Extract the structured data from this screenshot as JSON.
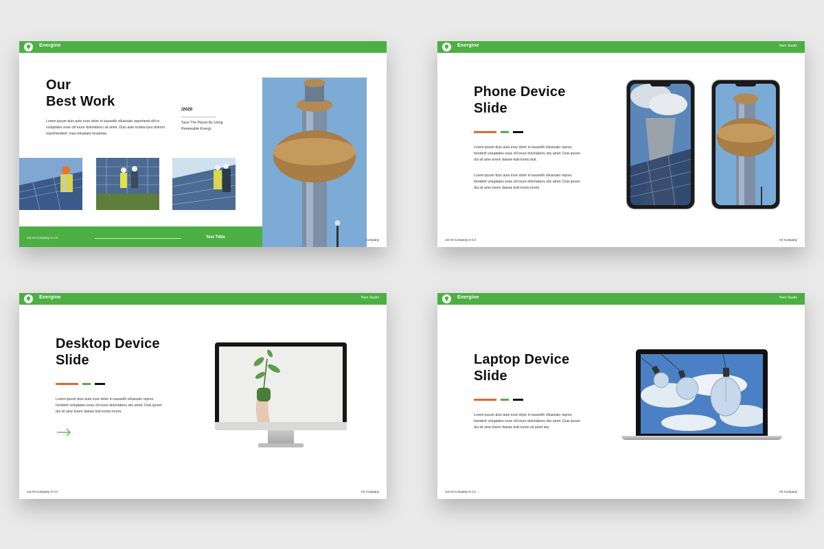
{
  "brand": "Energine",
  "studio": "Yeen Studio",
  "footer_left": "1st Art Company in CA",
  "footer_right": "Art Company",
  "slide1": {
    "title": "Our\nBest Work",
    "body": "Lorem ipsum duis aute irure dolor in kauselih ollusioalo reprehenit cilli in voluptates esse cill inure dolorlaboru sit amet. Duis aute irulsita ipsu dolorin reprehenderit. insa voluptate lorasinae.",
    "year": "/2020",
    "tagline": "Save The Planet By Using\nRenewable Energy",
    "green_label": "Test Tittle",
    "footer_right_partial": "Company"
  },
  "slide2": {
    "title": "Phone Device\nSlide",
    "body1": "Lorem ipsum duis aute irure dolor in kauselih ollusioalo repres henderit voluptates esse cill inure dolorlaboru sits amet. Duis ipsum dui sit ame lorem daiose kuili konto duit.",
    "body2": "Lorem ipsum duis aute irure dolor in kauselih ollusioalo repres henderit voluptates esse cill inure dolorlaboru sits amet. Duis ipsum dui sit ame lorem daiose kuili konto lorem."
  },
  "slide3": {
    "title": "Desktop Device\nSlide",
    "body": "Lorem ipsum duis aute irure dolor in kauselih ollusioalo repres henderit voluptates esse cill inure dolorlaboru sits amet. Duis ipsum dui sit ame lorem daiose kuili konto lorem.",
    "arrow_icon": "arrow-right-icon"
  },
  "slide4": {
    "title": "Laptop Device\nSlide",
    "body": "Lorem ipsum duis aute irure dolor in kauselih ollusioalo repres henderit voluptates esse cill inure dolorlaboru sits amet. Duis ipsum dui sit ame lorem daiose kuili konto sit amet dut."
  },
  "colors": {
    "accent_green": "#4caf43",
    "accent_orange": "#e2682d",
    "dark": "#111111"
  }
}
